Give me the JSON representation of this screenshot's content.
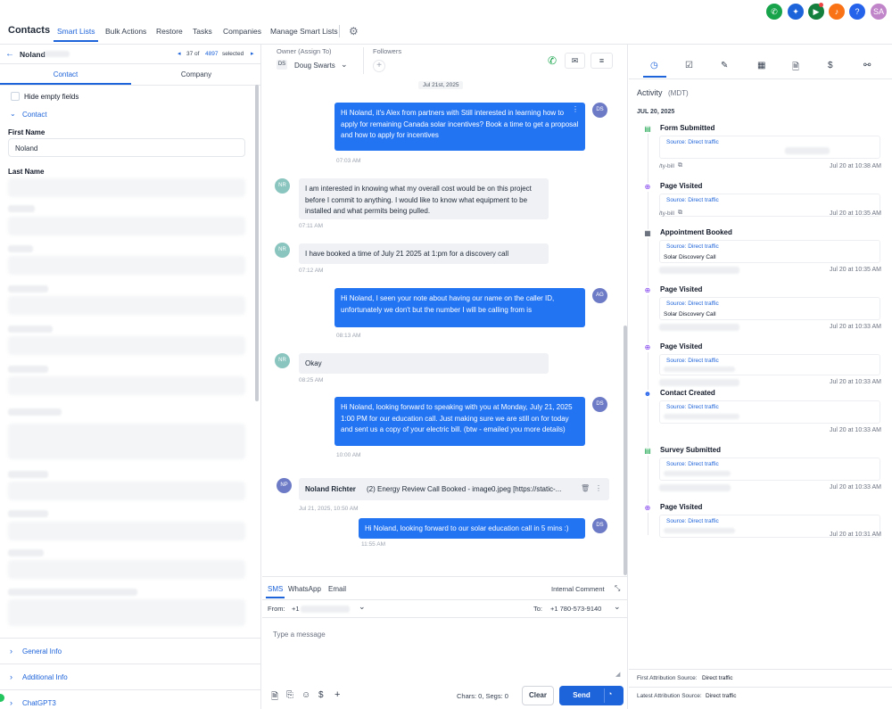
{
  "topbar": {
    "title": "Contacts",
    "tabs": [
      "Smart Lists",
      "Bulk Actions",
      "Restore",
      "Tasks",
      "Companies",
      "Manage Smart Lists"
    ],
    "user_initials": "SA"
  },
  "left": {
    "contact_name": "Noland",
    "position": "37 of",
    "total": "4897",
    "selected_label": "selected",
    "tabs": [
      "Contact",
      "Company"
    ],
    "hide_empty": "Hide empty fields",
    "section": "Contact",
    "first_name_label": "First Name",
    "first_name_value": "Noland",
    "last_name_label": "Last Name",
    "bottom_sections": [
      "General Info",
      "Additional Info",
      "ChatGPT3"
    ]
  },
  "center": {
    "owner_label": "Owner (Assign To)",
    "owner_initials": "DS",
    "owner_name": "Doug Swarts",
    "followers_label": "Followers",
    "date_pill": "Jul 21st, 2025",
    "messages": [
      {
        "text": "Hi Noland, it's Alex from                     partners with                       Still interested in learning how to apply for remaining Canada solar incentives? Book a time to get a proposal and how to apply for incentives",
        "time": "07:03 AM",
        "avatar": "DS"
      },
      {
        "text": "I am interested in knowing what my overall cost would be on this project before I commit to anything. I would like to know what equipment to be installed and what permits being pulled.",
        "time": "07:11 AM",
        "avatar": "NR"
      },
      {
        "text": "I have booked a time of July 21 2025 at 1:pm for a discovery call",
        "time": "07:12 AM",
        "avatar": "NR"
      },
      {
        "text": "Hi Noland, I seen your note about having our name on the caller ID, unfortunately we don't but the number I will be calling from is",
        "time": "08:13 AM",
        "avatar": "AG"
      },
      {
        "text": "Okay",
        "time": "08:25 AM",
        "avatar": "NR"
      },
      {
        "text": "Hi Noland, looking forward to speaking with you at Monday, July 21, 2025 1:00 PM for our education call. Just making sure we are still on for today and sent us a copy of your electric bill. (btw - emailed you more details)",
        "time": "10:00 AM",
        "avatar": "DS"
      },
      {
        "text": "Hi Noland, looking forward to our solar education call in 5 mins :)",
        "time": "11:55 AM",
        "avatar": "DS"
      }
    ],
    "note": {
      "sender": "Noland Richter",
      "body": "(2)  Energy Review Call Booked  -  image0.jpeg [https://static-...",
      "time": "Jul 21, 2025, 10:50 AM",
      "avatar": "NP"
    },
    "composer": {
      "tabs": [
        "SMS",
        "WhatsApp",
        "Email"
      ],
      "internal_comment": "Internal Comment",
      "from_label": "From:",
      "from_value": "+1",
      "to_label": "To:",
      "to_value": "+1 780-573-9140",
      "placeholder": "Type a message",
      "counter": "Chars: 0, Segs: 0",
      "clear": "Clear",
      "send": "Send"
    }
  },
  "right": {
    "activity_title": "Activity",
    "timezone": "(MDT)",
    "day": "JUL 20, 2025",
    "items": [
      {
        "title": "Form Submitted",
        "source": "Source: Direct traffic",
        "link": "/ty-bill",
        "date": "Jul 20 at 10:38 AM"
      },
      {
        "title": "Page Visited",
        "source": "Source: Direct traffic",
        "link": "/ty-bill",
        "date": "Jul 20 at 10:35 AM"
      },
      {
        "title": "Appointment Booked",
        "source": "Source: Direct traffic",
        "detail": "Solar Discovery Call",
        "date": "Jul 20 at 10:35 AM"
      },
      {
        "title": "Page Visited",
        "source": "Source: Direct traffic",
        "detail": "Solar Discovery Call",
        "date": "Jul 20 at 10:33 AM"
      },
      {
        "title": "Page Visited",
        "source": "Source: Direct traffic",
        "date": "Jul 20 at 10:33 AM"
      },
      {
        "title": "Contact Created",
        "source": "Source: Direct traffic",
        "date": "Jul 20 at 10:33 AM"
      },
      {
        "title": "Survey Submitted",
        "source": "Source: Direct traffic",
        "date": "Jul 20 at 10:33 AM"
      },
      {
        "title": "Page Visited",
        "source": "Source: Direct traffic",
        "date": "Jul 20 at 10:31 AM"
      }
    ],
    "first_attr_label": "First Attribution Source:",
    "first_attr_value": "Direct traffic",
    "latest_attr_label": "Latest Attribution Source:",
    "latest_attr_value": "Direct traffic"
  },
  "colors": {
    "accent": "#1d63d9",
    "outgoing": "#2374f2",
    "incoming": "#eff1f5"
  }
}
